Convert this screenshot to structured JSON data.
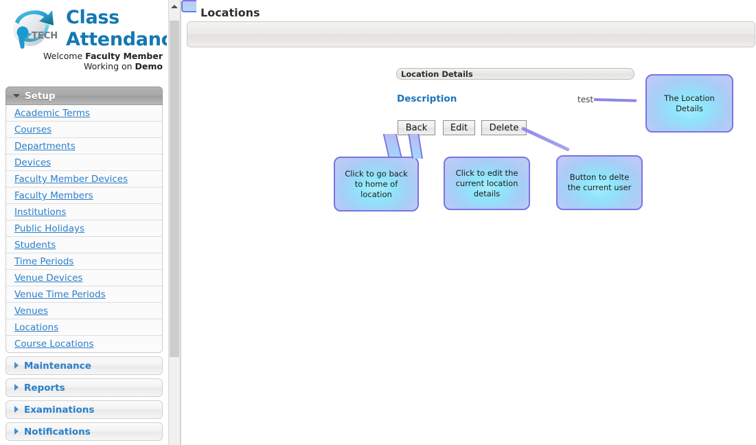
{
  "brand": {
    "title_line1": "Class",
    "title_line2": "Attendance",
    "welcome_prefix": "Welcome ",
    "welcome_user": "Faculty Member",
    "working_prefix": "Working on ",
    "working_value": "Demo",
    "logo_text": "iPTECH",
    "accent_color": "#1378b4"
  },
  "sidebar": {
    "setup": {
      "label": "Setup",
      "items": [
        {
          "label": "Academic Terms"
        },
        {
          "label": "Courses"
        },
        {
          "label": "Departments"
        },
        {
          "label": "Devices"
        },
        {
          "label": "Faculty Member Devices"
        },
        {
          "label": "Faculty Members"
        },
        {
          "label": "Institutions"
        },
        {
          "label": "Public Holidays"
        },
        {
          "label": "Students"
        },
        {
          "label": "Time Periods"
        },
        {
          "label": "Venue Devices"
        },
        {
          "label": "Venue Time Periods"
        },
        {
          "label": "Venues"
        },
        {
          "label": "Locations"
        },
        {
          "label": "Course Locations"
        }
      ]
    },
    "collapsed_sections": [
      {
        "label": "Maintenance"
      },
      {
        "label": "Reports"
      },
      {
        "label": "Examinations"
      },
      {
        "label": "Notifications"
      }
    ],
    "link_color": "#2a7fc9"
  },
  "main": {
    "page_title": "Locations",
    "panel_title": "Location Details",
    "fields": [
      {
        "label": "Description",
        "value": "test"
      }
    ],
    "buttons": [
      {
        "label": "Back"
      },
      {
        "label": "Edit"
      },
      {
        "label": "Delete"
      }
    ]
  },
  "callouts": [
    {
      "id": "details",
      "text": "The Location Details"
    },
    {
      "id": "back",
      "text": "Click to go back to home of location"
    },
    {
      "id": "edit",
      "text": "Click to edit the current location details"
    },
    {
      "id": "delete",
      "text": "Button to delte the current user"
    }
  ],
  "callout_style": {
    "border_color": "#7b74e0",
    "fill_color": "#8fe4fb"
  },
  "scrollbar": {
    "up_arrow": "scroll-up-arrow"
  }
}
